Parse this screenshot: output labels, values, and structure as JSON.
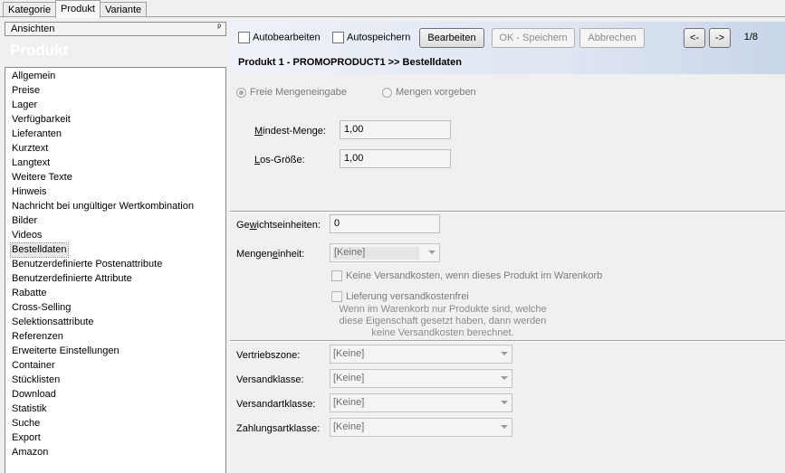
{
  "tabs": [
    "Kategorie",
    "Produkt",
    "Variante"
  ],
  "left": {
    "header": "Ansichten",
    "pin": "ᵖ",
    "banner": "Produkt",
    "items": [
      "Allgemein",
      "Preise",
      "Lager",
      "Verfügbarkeit",
      "Lieferanten",
      "Kurztext",
      "Langtext",
      "Weitere Texte",
      "Hinweis",
      "Nachricht bei ungültiger Wertkombination",
      "Bilder",
      "Videos",
      "Bestelldaten",
      "Benutzerdefinierte Postenattribute",
      "Benutzerdefinierte Attribute",
      "Rabatte",
      "Cross-Selling",
      "Selektionsattribute",
      "Referenzen",
      "Erweiterte Einstellungen",
      "Container",
      "Stücklisten",
      "Download",
      "Statistik",
      "Suche",
      "Export",
      "Amazon"
    ],
    "selected_index": 12
  },
  "toolbar": {
    "auto_edit": "Autobearbeiten",
    "auto_save": "Autospeichern",
    "edit": "Bearbeiten",
    "ok_save": "OK - Speichern",
    "cancel": "Abbrechen",
    "prev": "<-",
    "next": "->",
    "page": "1/8"
  },
  "breadcrumb": "Produkt 1 - PROMOPRODUCT1 >> Bestelldaten",
  "form": {
    "radio_free": "Freie Mengeneingabe",
    "radio_fixed": "Mengen vorgeben",
    "min_qty_label_ul": "M",
    "min_qty_label_rest": "indest-Menge:",
    "min_qty_value": "1,00",
    "lot_size_label_ul": "L",
    "lot_size_label_rest": "os-Größe:",
    "lot_size_value": "1,00",
    "weight_units_label_a": "Ge",
    "weight_units_label_ul": "w",
    "weight_units_label_b": "ichtseinheiten:",
    "weight_units_value": "0",
    "qty_unit_label_a": "Mengen",
    "qty_unit_label_ul": "e",
    "qty_unit_label_b": "inheit:",
    "qty_unit_value": "[Keine]",
    "no_shipping_costs": "Keine Versandkosten, wenn dieses Produkt im Warenkorb",
    "free_delivery": "Lieferung versandkostenfrei",
    "free_delivery_note": [
      "Wenn im Warenkorb nur Produkte sind, welche",
      "diese Eigenschaft gesetzt haben, dann werden",
      "keine Versandkosten berechnet."
    ],
    "sales_zone_label": "Vertriebszone:",
    "sales_zone_value": "[Keine]",
    "shipping_class_label": "Versandklasse:",
    "shipping_class_value": "[Keine]",
    "shipping_type_class_label": "Versandartklasse:",
    "shipping_type_class_value": "[Keine]",
    "payment_type_class_label": "Zahlungsartklasse:",
    "payment_type_class_value": "[Keine]"
  }
}
